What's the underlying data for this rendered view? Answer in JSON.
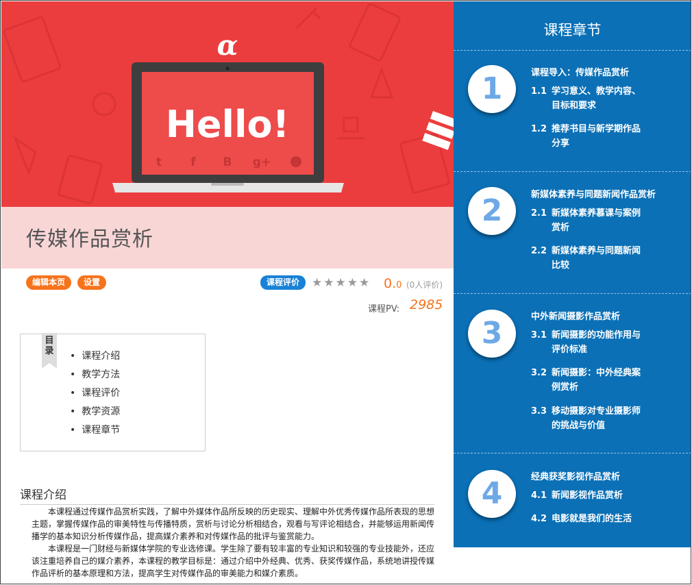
{
  "banner": {
    "screen_text": "Hello!",
    "logo_glyph": "ɑ",
    "social_icons": [
      "twitter-icon",
      "facebook-icon",
      "blogger-icon",
      "googleplus-icon",
      "github-icon"
    ],
    "colors": {
      "bg": "#ec3d3e",
      "screen": "#ee4b4b",
      "laptop": "#3e3e3e"
    }
  },
  "course": {
    "title": "传媒作品赏析"
  },
  "actions": {
    "edit_label": "编辑本页",
    "settings_label": "设置",
    "review_label": "课程评价",
    "stars": "★★★★★",
    "score_main": "0.",
    "score_decimal": "0",
    "rating_count": "(0人评价)",
    "pv_label": "课程PV:",
    "pv_value": "2985"
  },
  "toc": {
    "tag": "目录",
    "items": [
      "课程介绍",
      "教学方法",
      "课程评价",
      "教学资源",
      "课程章节"
    ]
  },
  "intro": {
    "title": "课程介绍",
    "paragraphs": [
      "本课程通过传媒作品赏析实践，了解中外媒体作品所反映的历史现实、理解中外优秀传媒作品所表现的思想主题，掌握传媒作品的审美特性与传播特质，赏析与讨论分析相结合，观看与写评论相结合，并能够运用新闻传播学的基本知识分析传媒作品，提高媒介素养和对传媒作品的批评与鉴赏能力。",
      "本课程是一门财经与新媒体学院的专业选修课。学生除了要有较丰富的专业知识和较强的专业技能外，还应该注重培养自己的媒介素养，本课程的教学目标是：通过介绍中外经典、优秀、获奖传媒作品，系统地讲授传媒作品评析的基本原理和方法，提高学生对传媒作品的审美能力和媒介素质。"
    ]
  },
  "chapters_panel": {
    "title": "课程章节",
    "color": "#0b70b6",
    "chapters": [
      {
        "number": "1",
        "title": "课程导入：传媒作品赏析",
        "sections": [
          {
            "num": "1.1",
            "title": "学习意义、教学内容、目标和要求"
          },
          {
            "num": "1.2",
            "title": "推荐书目与新学期作品分享"
          }
        ]
      },
      {
        "number": "2",
        "title": "新媒体素养与同题新闻作品赏析",
        "sections": [
          {
            "num": "2.1",
            "title": "新媒体素养慕课与案例赏析"
          },
          {
            "num": "2.2",
            "title": "新媒体素养与同题新闻比较"
          }
        ]
      },
      {
        "number": "3",
        "title": "中外新闻摄影作品赏析",
        "sections": [
          {
            "num": "3.1",
            "title": "新闻摄影的功能作用与评价标准"
          },
          {
            "num": "3.2",
            "title": "新闻摄影：中外经典案例赏析"
          },
          {
            "num": "3.3",
            "title": "移动摄影对专业摄影师的挑战与价值"
          }
        ]
      },
      {
        "number": "4",
        "title": "经典获奖影视作品赏析",
        "sections": [
          {
            "num": "4.1",
            "title": "新闻影视作品赏析"
          },
          {
            "num": "4.2",
            "title": "电影就是我们的生活"
          }
        ]
      }
    ]
  }
}
